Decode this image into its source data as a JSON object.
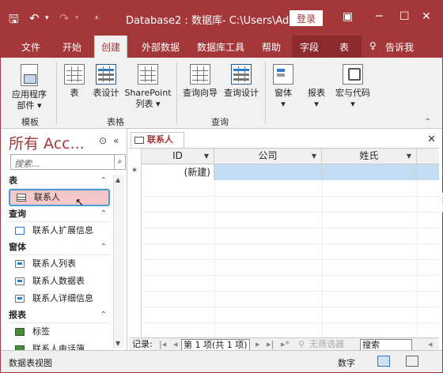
{
  "titlebar": {
    "save_icon": "save-icon",
    "undo_icon": "undo-icon",
    "redo_icon": "redo-icon",
    "customize_icon": "customize-qat-icon",
    "title": "Database2 : 数据库- C:\\Users\\Ad...",
    "login_label": "登录",
    "restore_icon": "ribbon-display-icon",
    "minimize_icon": "minimize-icon",
    "maximize_icon": "maximize-icon",
    "close_icon": "close-icon"
  },
  "tabs": [
    {
      "label": "文件"
    },
    {
      "label": "开始"
    },
    {
      "label": "创建"
    },
    {
      "label": "外部数据"
    },
    {
      "label": "数据库工具"
    },
    {
      "label": "帮助"
    },
    {
      "label": "字段"
    },
    {
      "label": "表"
    },
    {
      "label": "告诉我"
    }
  ],
  "active_tab": "创建",
  "ribbon": {
    "groups": [
      {
        "label": "模板",
        "buttons": [
          {
            "label": "应用程序\n部件 ▾"
          }
        ]
      },
      {
        "label": "表格",
        "buttons": [
          {
            "label": "表"
          },
          {
            "label": "表设计"
          },
          {
            "label": "SharePoint\n列表 ▾"
          }
        ]
      },
      {
        "label": "查询",
        "buttons": [
          {
            "label": "查询向导"
          },
          {
            "label": "查询设计"
          }
        ]
      },
      {
        "label": "",
        "buttons": [
          {
            "label": "窗体\n▾"
          },
          {
            "label": "报表\n▾"
          },
          {
            "label": "宏与代码\n▾"
          }
        ]
      }
    ],
    "collapse_icon": "chevron-up-icon"
  },
  "nav": {
    "title": "所有 Acc...",
    "search_placeholder": "搜索...",
    "categories": [
      {
        "label": "表",
        "items": [
          {
            "label": "联系人",
            "icon": "table-icon",
            "selected": true
          }
        ]
      },
      {
        "label": "查询",
        "items": [
          {
            "label": "联系人扩展信息",
            "icon": "query-icon"
          }
        ]
      },
      {
        "label": "窗体",
        "items": [
          {
            "label": "联系人列表",
            "icon": "form-icon"
          },
          {
            "label": "联系人数据表",
            "icon": "form-icon"
          },
          {
            "label": "联系人详细信息",
            "icon": "form-icon"
          }
        ]
      },
      {
        "label": "报表",
        "items": [
          {
            "label": "标签",
            "icon": "report-icon"
          },
          {
            "label": "联系人电话簿",
            "icon": "report-icon"
          }
        ]
      }
    ]
  },
  "document": {
    "tab_label": "联系人",
    "columns": [
      "ID",
      "公司",
      "姓氏"
    ],
    "new_row_marker": "*",
    "new_row_id": "(新建)"
  },
  "record_nav": {
    "label": "记录:",
    "first": "|◂",
    "prev": "◂",
    "position": "第 1 项(共 1 项)",
    "next": "▸",
    "last": "▸|",
    "new": "▸*",
    "filter_label": "无筛选器",
    "search_label": "搜索"
  },
  "status": {
    "view_label": "数据表视图",
    "numlock": "数字"
  }
}
